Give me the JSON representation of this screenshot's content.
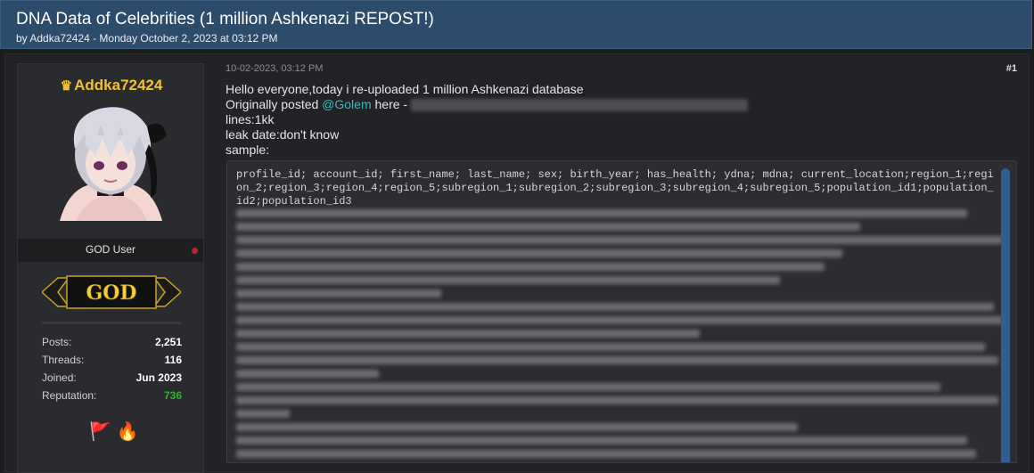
{
  "thread": {
    "title": "DNA Data of Celebrities (1 million Ashkenazi REPOST!)",
    "meta": "by Addka72424 - Monday October 2, 2023 at 03:12 PM"
  },
  "user": {
    "name": "Addka72424",
    "rank": "GOD User",
    "badge": "GOD",
    "stats": [
      {
        "label": "Posts:",
        "value": "2,251"
      },
      {
        "label": "Threads:",
        "value": "116"
      },
      {
        "label": "Joined:",
        "value": "Jun 2023"
      },
      {
        "label": "Reputation:",
        "value": "736"
      }
    ],
    "awards": [
      "🚩",
      "🔥"
    ]
  },
  "post": {
    "date": "10-02-2023, 03:12 PM",
    "number": "#1",
    "line1": "Hello everyone,today i re-uploaded 1 million Ashkenazi database",
    "line2_prefix": "Originally posted ",
    "mention": "@Golem",
    "line2_suffix": "  here -",
    "line3": "lines:1kk",
    "line4": "leak date:don't know",
    "line5": "sample:",
    "code_header": "profile_id; account_id; first_name; last_name; sex; birth_year; has_health; ydna; mdna; current_location;region_1;region_2;region_3;region_4;region_5;subregion_1;subregion_2;subregion_3;subregion_4;subregion_5;population_id1;population_id2;population_id3"
  },
  "colors": {
    "header_bg": "#2d4c6b",
    "username": "#f0c233",
    "mention": "#39b8c6",
    "reputation": "#2fb52f",
    "scrollbar": "#2f5e91"
  },
  "icons": [
    "crown-icon",
    "status-dot-icon",
    "flag-icon",
    "fire-icon"
  ]
}
